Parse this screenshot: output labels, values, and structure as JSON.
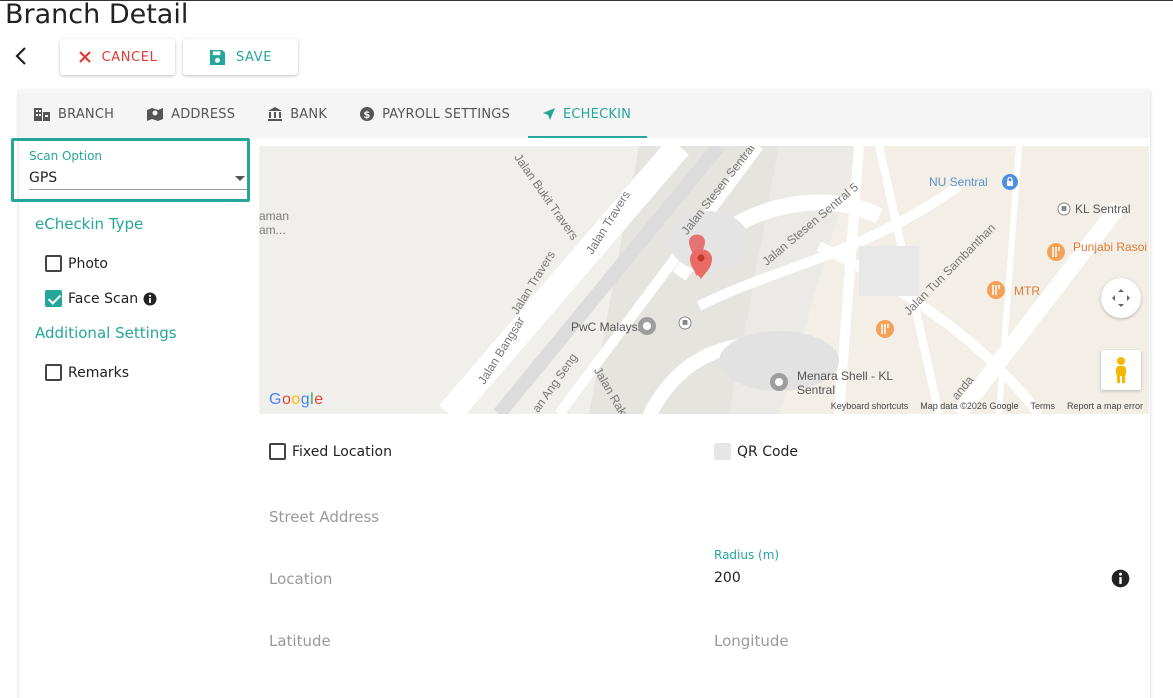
{
  "page": {
    "title": "Branch Detail"
  },
  "toolbar": {
    "cancel_label": "CANCEL",
    "save_label": "SAVE"
  },
  "tabs": [
    {
      "label": "BRANCH",
      "icon": "branch-icon"
    },
    {
      "label": "ADDRESS",
      "icon": "map-icon"
    },
    {
      "label": "BANK",
      "icon": "bank-icon"
    },
    {
      "label": "PAYROLL SETTINGS",
      "icon": "payroll-icon"
    },
    {
      "label": "ECHECKIN",
      "icon": "location-arrow-icon",
      "active": true
    }
  ],
  "scan": {
    "label": "Scan Option",
    "value": "GPS"
  },
  "echeckin_type": {
    "title": "eCheckin Type",
    "photo": {
      "label": "Photo",
      "checked": false
    },
    "face_scan": {
      "label": "Face Scan",
      "checked": true
    }
  },
  "additional": {
    "title": "Additional Settings",
    "remarks": {
      "label": "Remarks",
      "checked": false
    }
  },
  "map": {
    "roads": [
      "Jalan Bukit Travers",
      "Jalan Travers",
      "Jalan Travers",
      "Jalan Stesen Sentral",
      "Jalan Stesen Sentral 5",
      "Jalan Tun Sambanthan",
      "Jalan Bangsar",
      "Jalan Rakyat",
      "an Ang Seng",
      "anda"
    ],
    "places": [
      "NU Sentral",
      "KL Sentral",
      "Punjabi Rasoi - Brickfields",
      "MTR",
      "PwC Malaysia",
      "Menara Shell - KL Sentral"
    ],
    "partial_labels": [
      "aman",
      "am..."
    ],
    "footer": [
      "Keyboard shortcuts",
      "Map data ©2026 Google",
      "Terms",
      "Report a map error"
    ],
    "logo": "Google"
  },
  "form": {
    "fixed_location": {
      "label": "Fixed Location",
      "checked": false
    },
    "qr_code": {
      "label": "QR Code",
      "checked": false,
      "disabled": true
    },
    "street_address": "Street Address",
    "location": "Location",
    "radius_label": "Radius (m)",
    "radius_value": "200",
    "latitude": "Latitude",
    "longitude": "Longitude"
  },
  "colors": {
    "accent": "#26a69a",
    "danger": "#e53935"
  }
}
